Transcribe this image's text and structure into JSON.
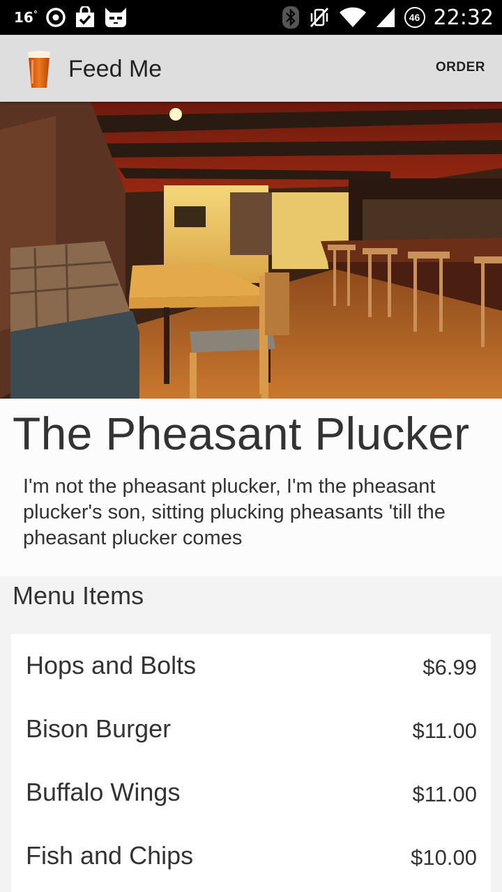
{
  "status_bar": {
    "temperature": "16",
    "temperature_unit": "°",
    "badge": "46",
    "time": "22:32"
  },
  "action_bar": {
    "title": "Feed Me",
    "order_label": "ORDER",
    "icon": "beer-glass-icon"
  },
  "place": {
    "name": "The Pheasant Plucker",
    "description": "I'm not the pheasant plucker, I'm the pheasant plucker's son, sitting plucking pheasants 'till the pheasant plucker comes"
  },
  "menu": {
    "header": "Menu Items",
    "items": [
      {
        "name": "Hops and Bolts",
        "price": "$6.99"
      },
      {
        "name": "Bison Burger",
        "price": "$11.00"
      },
      {
        "name": "Buffalo Wings",
        "price": "$11.00"
      },
      {
        "name": "Fish and Chips",
        "price": "$10.00"
      }
    ]
  }
}
